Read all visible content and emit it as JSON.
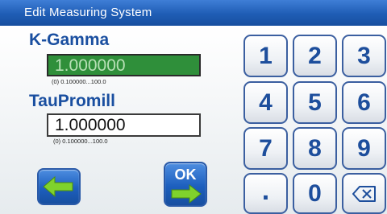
{
  "window": {
    "title": "Edit Measuring System"
  },
  "fields": [
    {
      "label": "K-Gamma",
      "value": "1.000000",
      "range": "(0) 0.100000...100.0"
    },
    {
      "label": "TauPromill",
      "value": "1.000000",
      "range": "(0) 0.100000...100.0"
    }
  ],
  "buttons": {
    "ok_label": "OK"
  },
  "keypad": {
    "keys": [
      "1",
      "2",
      "3",
      "4",
      "5",
      "6",
      "7",
      "8",
      "9",
      ".",
      "0"
    ],
    "backspace_icon": "backspace-icon"
  },
  "colors": {
    "title_bar": "#1f5db5",
    "label": "#1a4fa0",
    "active_field": "#2f8f3a",
    "arrow_green": "#7fd22c"
  }
}
